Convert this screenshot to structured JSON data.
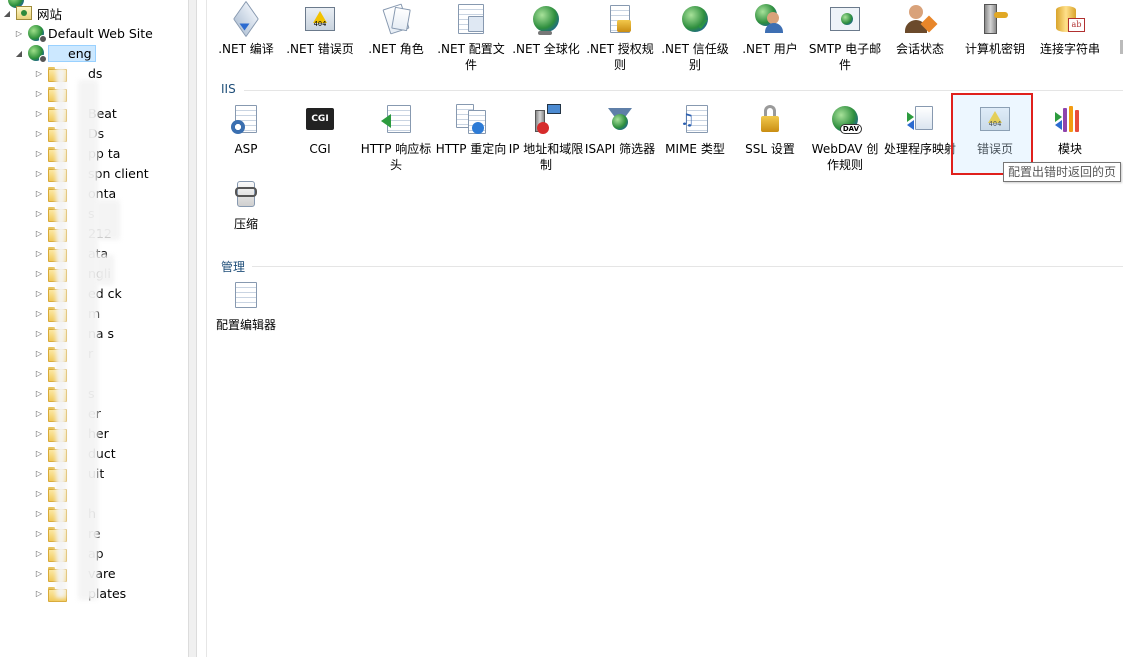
{
  "tree": {
    "root_label": "网站",
    "default_site": "Default Web Site",
    "selected_site": "eng",
    "folders": [
      {
        "label": "ds"
      },
      {
        "label": ""
      },
      {
        "label": "Beat"
      },
      {
        "label": "Ds"
      },
      {
        "label": "pp  ta"
      },
      {
        "label": "spn  client"
      },
      {
        "label": "onta"
      },
      {
        "label": "s"
      },
      {
        "label": "212"
      },
      {
        "label": "ata"
      },
      {
        "label": "ngli"
      },
      {
        "label": "ed   ck"
      },
      {
        "label": "m"
      },
      {
        "label": "na   s"
      },
      {
        "label": "r"
      },
      {
        "label": ""
      },
      {
        "label": "s"
      },
      {
        "label": "er"
      },
      {
        "label": "her"
      },
      {
        "label": "duct"
      },
      {
        "label": "uit"
      },
      {
        "label": ""
      },
      {
        "label": "h"
      },
      {
        "label": "re"
      },
      {
        "label": "ap"
      },
      {
        "label": "vare"
      },
      {
        "label": "plates"
      }
    ]
  },
  "features": {
    "aspnet": [
      {
        "name": "net-compile-icon",
        "label": ".NET 编译"
      },
      {
        "name": "net-error-pages-icon",
        "label": ".NET 错误页"
      },
      {
        "name": "net-roles-icon",
        "label": ".NET 角色"
      },
      {
        "name": "net-config-file-icon",
        "label": ".NET 配置文件"
      },
      {
        "name": "net-globalization-icon",
        "label": ".NET 全球化"
      },
      {
        "name": "net-authorization-icon",
        "label": ".NET 授权规则"
      },
      {
        "name": "net-trust-levels-icon",
        "label": ".NET 信任级别"
      },
      {
        "name": "net-users-icon",
        "label": ".NET 用户"
      },
      {
        "name": "smtp-email-icon",
        "label": "SMTP 电子邮件"
      },
      {
        "name": "session-state-icon",
        "label": "会话状态"
      },
      {
        "name": "machine-key-icon",
        "label": "计算机密钥"
      },
      {
        "name": "connection-strings-icon",
        "label": "连接字符串"
      }
    ],
    "iis_title": "IIS",
    "iis": [
      {
        "name": "asp-icon",
        "label": "ASP"
      },
      {
        "name": "cgi-icon",
        "label": "CGI",
        "badge": "CGI"
      },
      {
        "name": "http-response-headers-icon",
        "label": "HTTP 响应标头"
      },
      {
        "name": "http-redirect-icon",
        "label": "HTTP 重定向"
      },
      {
        "name": "ip-domain-restrictions-icon",
        "label": "IP 地址和域限制"
      },
      {
        "name": "isapi-filters-icon",
        "label": "ISAPI 筛选器"
      },
      {
        "name": "mime-types-icon",
        "label": "MIME 类型"
      },
      {
        "name": "ssl-settings-icon",
        "label": "SSL 设置"
      },
      {
        "name": "webdav-authoring-icon",
        "label": "WebDAV 创作规则",
        "badge": "DAV"
      },
      {
        "name": "handler-mappings-icon",
        "label": "处理程序映射"
      },
      {
        "name": "error-pages-icon",
        "label": "错误页",
        "badge": "404"
      },
      {
        "name": "modules-icon",
        "label": "模块"
      },
      {
        "name": "compression-icon",
        "label": "压缩"
      }
    ],
    "manage_title": "管理",
    "manage": [
      {
        "name": "config-editor-icon",
        "label": "配置编辑器"
      }
    ]
  },
  "tooltip": "配置出错时返回的页",
  "badges": {
    "error404": "404",
    "cgi": "CGI",
    "dav": "DAV",
    "ab": "ab"
  },
  "colors": {
    "highlight_border": "#e0201c",
    "selection": "#cce8ff",
    "section_title": "#1f4e79"
  }
}
